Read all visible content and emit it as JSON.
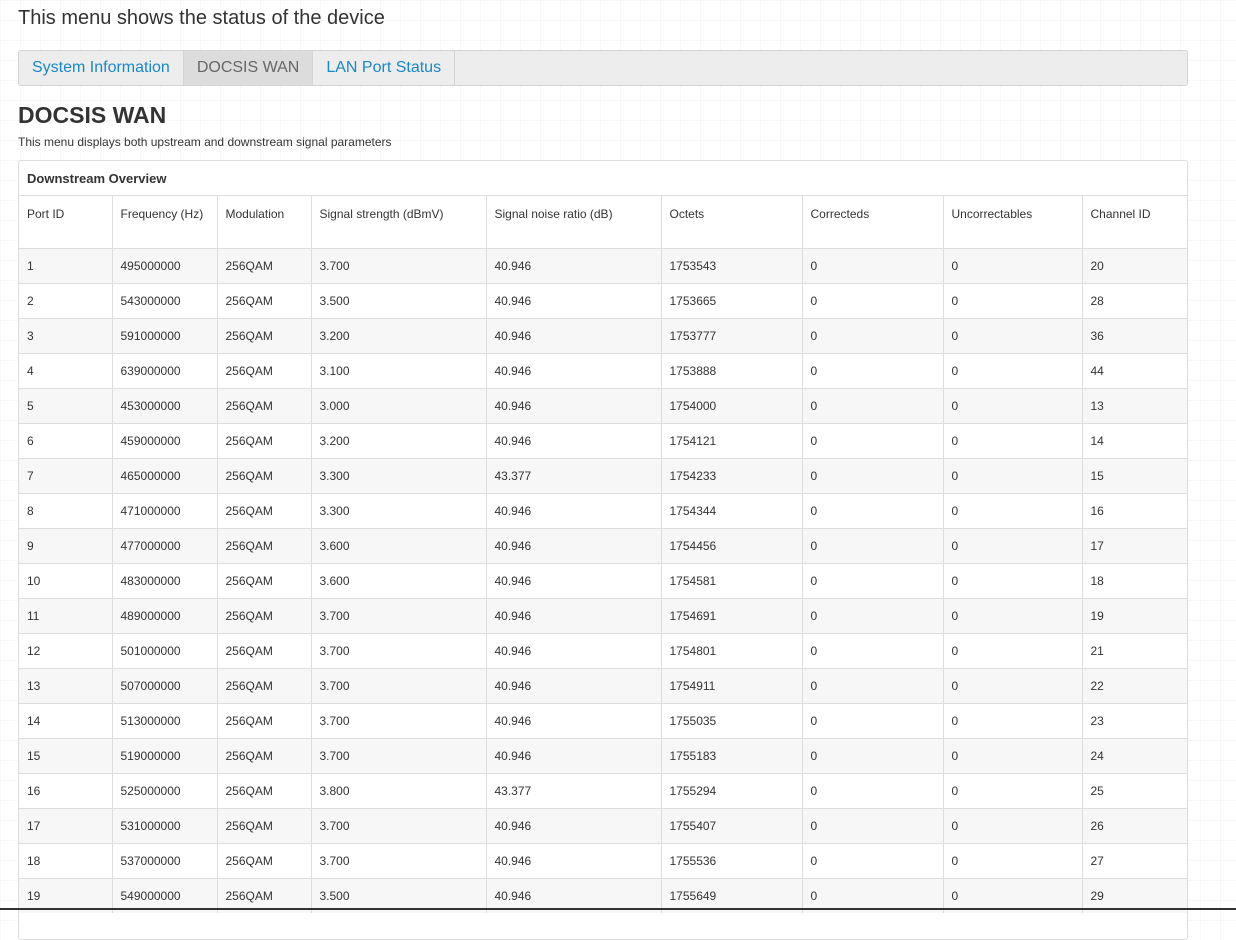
{
  "page": {
    "heading": "This menu shows the status of the device"
  },
  "tabs": [
    {
      "label": "System Information",
      "active": false
    },
    {
      "label": "DOCSIS WAN",
      "active": true
    },
    {
      "label": "LAN Port Status",
      "active": false
    }
  ],
  "section": {
    "title": "DOCSIS WAN",
    "description": "This menu displays both upstream and downstream signal parameters"
  },
  "downstream": {
    "panel_title": "Downstream Overview",
    "columns": [
      "Port ID",
      "Frequency (Hz)",
      "Modulation",
      "Signal strength (dBmV)",
      "Signal noise ratio (dB)",
      "Octets",
      "Correcteds",
      "Uncorrectables",
      "Channel ID"
    ],
    "rows": [
      [
        "1",
        "495000000",
        "256QAM",
        "3.700",
        "40.946",
        "1753543",
        "0",
        "0",
        "20"
      ],
      [
        "2",
        "543000000",
        "256QAM",
        "3.500",
        "40.946",
        "1753665",
        "0",
        "0",
        "28"
      ],
      [
        "3",
        "591000000",
        "256QAM",
        "3.200",
        "40.946",
        "1753777",
        "0",
        "0",
        "36"
      ],
      [
        "4",
        "639000000",
        "256QAM",
        "3.100",
        "40.946",
        "1753888",
        "0",
        "0",
        "44"
      ],
      [
        "5",
        "453000000",
        "256QAM",
        "3.000",
        "40.946",
        "1754000",
        "0",
        "0",
        "13"
      ],
      [
        "6",
        "459000000",
        "256QAM",
        "3.200",
        "40.946",
        "1754121",
        "0",
        "0",
        "14"
      ],
      [
        "7",
        "465000000",
        "256QAM",
        "3.300",
        "43.377",
        "1754233",
        "0",
        "0",
        "15"
      ],
      [
        "8",
        "471000000",
        "256QAM",
        "3.300",
        "40.946",
        "1754344",
        "0",
        "0",
        "16"
      ],
      [
        "9",
        "477000000",
        "256QAM",
        "3.600",
        "40.946",
        "1754456",
        "0",
        "0",
        "17"
      ],
      [
        "10",
        "483000000",
        "256QAM",
        "3.600",
        "40.946",
        "1754581",
        "0",
        "0",
        "18"
      ],
      [
        "11",
        "489000000",
        "256QAM",
        "3.700",
        "40.946",
        "1754691",
        "0",
        "0",
        "19"
      ],
      [
        "12",
        "501000000",
        "256QAM",
        "3.700",
        "40.946",
        "1754801",
        "0",
        "0",
        "21"
      ],
      [
        "13",
        "507000000",
        "256QAM",
        "3.700",
        "40.946",
        "1754911",
        "0",
        "0",
        "22"
      ],
      [
        "14",
        "513000000",
        "256QAM",
        "3.700",
        "40.946",
        "1755035",
        "0",
        "0",
        "23"
      ],
      [
        "15",
        "519000000",
        "256QAM",
        "3.700",
        "40.946",
        "1755183",
        "0",
        "0",
        "24"
      ],
      [
        "16",
        "525000000",
        "256QAM",
        "3.800",
        "43.377",
        "1755294",
        "0",
        "0",
        "25"
      ],
      [
        "17",
        "531000000",
        "256QAM",
        "3.700",
        "40.946",
        "1755407",
        "0",
        "0",
        "26"
      ],
      [
        "18",
        "537000000",
        "256QAM",
        "3.700",
        "40.946",
        "1755536",
        "0",
        "0",
        "27"
      ],
      [
        "19",
        "549000000",
        "256QAM",
        "3.500",
        "40.946",
        "1755649",
        "0",
        "0",
        "29"
      ]
    ]
  },
  "colors": {
    "link": "#1a87c6",
    "active_tab_text": "#666666",
    "text": "#333333",
    "border": "#dddddd"
  }
}
